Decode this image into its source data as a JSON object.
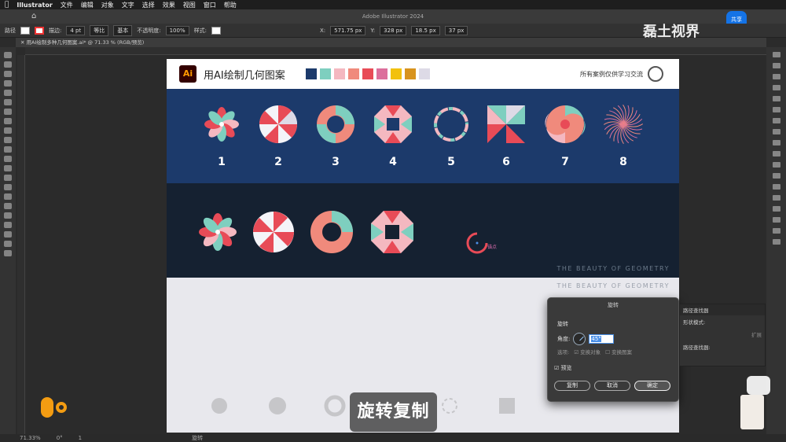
{
  "menubar": {
    "app": "Illustrator",
    "items": [
      "文件",
      "编辑",
      "对象",
      "文字",
      "选择",
      "效果",
      "视图",
      "窗口",
      "帮助"
    ]
  },
  "window": {
    "title": "Adobe Illustrator 2024",
    "share": "共享"
  },
  "control": {
    "path_label": "路径",
    "stroke_label": "描边:",
    "stroke_value": "4 pt",
    "stroke_style": "等比",
    "brush": "基本",
    "opacity_label": "不透明度:",
    "opacity_value": "100%",
    "style_label": "样式:",
    "x_label": "X:",
    "x_value": "571.75 px",
    "y_label": "Y:",
    "y_value": "328 px",
    "w_value": "18.5 px",
    "h_value": "37 px"
  },
  "doc_tab": "用AI绘制多种几何图案.ai* @ 71.33 % (RGB/预览)",
  "artboard": {
    "logo": "Ai",
    "title": "用AI绘制几何图案",
    "note": "所有案例仅供学习交流",
    "palette": [
      "#1c3a6b",
      "#7ecfbf",
      "#f4b8c0",
      "#f08a7c",
      "#e84b57",
      "#dc6f9c",
      "#f2c10f",
      "#d8931d",
      "#dddae6"
    ],
    "numbers": [
      "1",
      "2",
      "3",
      "4",
      "5",
      "6",
      "7",
      "8"
    ],
    "tagline": "THE BEAUTY OF GEOMETRY",
    "tagline2": "THE BEAUTY OF GEOMETRY",
    "anchor_label": "锚点"
  },
  "dialog": {
    "title": "旋转",
    "section": "旋转",
    "angle_label": "角度:",
    "angle_value": "45°",
    "options_label": "选项:",
    "opt1": "变换对象",
    "opt2": "变换图案",
    "preview": "预览",
    "copy": "复制",
    "cancel": "取消",
    "ok": "确定"
  },
  "pathpanel": {
    "title": "路径查找器",
    "shape_modes": "形状模式:",
    "pathfinders": "路径查找器:",
    "expand": "扩展"
  },
  "status": {
    "zoom": "71.33%",
    "rotate": "0°",
    "page": "1",
    "tool": "旋转"
  },
  "subtitle": "旋转复制",
  "watermark": "磊土视界"
}
